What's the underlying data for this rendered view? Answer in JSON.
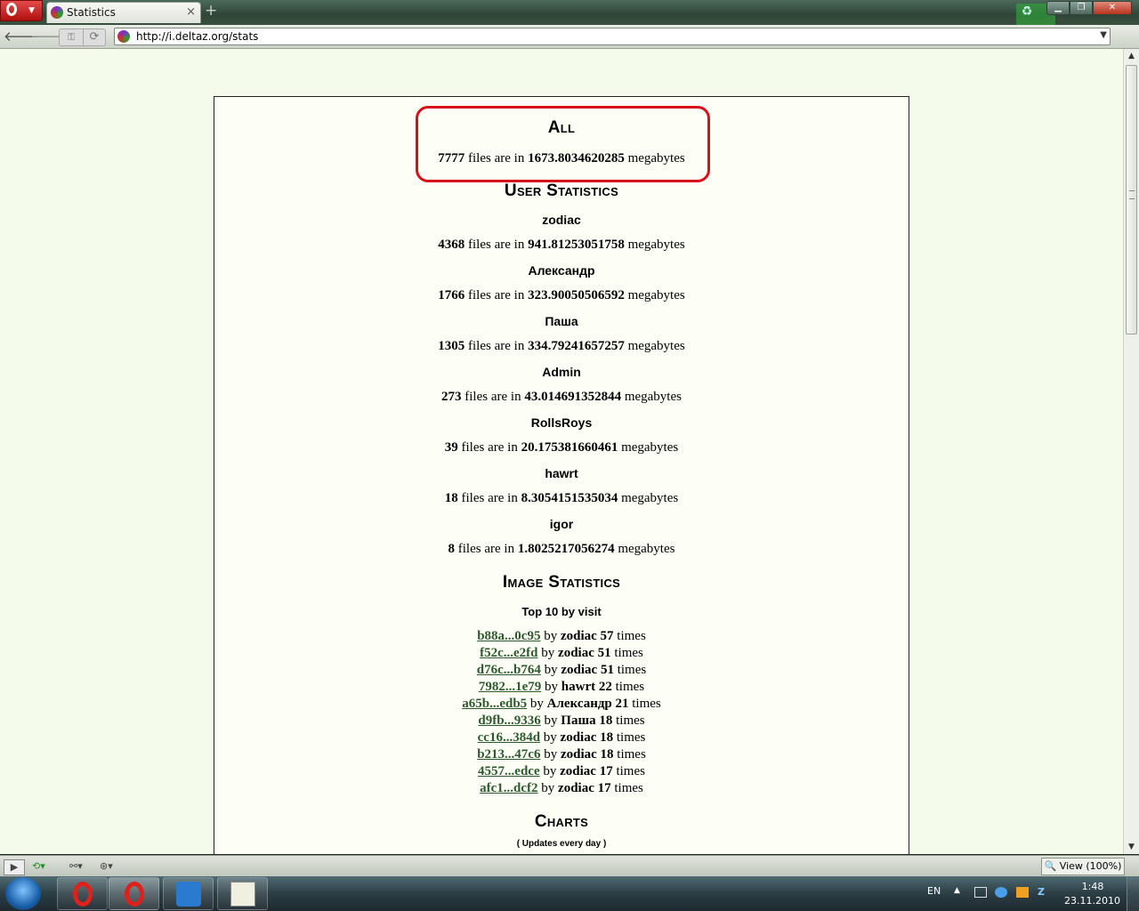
{
  "browser": {
    "tab_title": "Statistics",
    "tab_close": "×",
    "new_tab": "+",
    "url": "http://i.deltaz.org/stats",
    "zoom_label": "View (100%)"
  },
  "page": {
    "all": {
      "heading": "All",
      "files": "7777",
      "megabytes": "1673.8034620285",
      "mid_text": " files are in ",
      "unit_text": " megabytes"
    },
    "user_stats": {
      "heading": "User Statistics",
      "users": [
        {
          "name": "zodiac",
          "files": "4368",
          "megabytes": "941.81253051758"
        },
        {
          "name": "Александр",
          "files": "1766",
          "megabytes": "323.90050506592"
        },
        {
          "name": "Паша",
          "files": "1305",
          "megabytes": "334.79241657257"
        },
        {
          "name": "Admin",
          "files": "273",
          "megabytes": "43.014691352844"
        },
        {
          "name": "RollsRoys",
          "files": "39",
          "megabytes": "20.175381660461"
        },
        {
          "name": "hawrt",
          "files": "18",
          "megabytes": "8.3054151535034"
        },
        {
          "name": "igor",
          "files": "8",
          "megabytes": "1.8025217056274"
        }
      ]
    },
    "image_stats": {
      "heading": "Image Statistics",
      "subheading": "Top 10 by visit",
      "by_text": " by ",
      "times_text": " times",
      "items": [
        {
          "id": "b88a...0c95",
          "user": "zodiac",
          "count": "57"
        },
        {
          "id": "f52c...e2fd",
          "user": "zodiac",
          "count": "51"
        },
        {
          "id": "d76c...b764",
          "user": "zodiac",
          "count": "51"
        },
        {
          "id": "7982...1e79",
          "user": "hawrt",
          "count": "22"
        },
        {
          "id": "a65b...edb5",
          "user": "Александр",
          "count": "21"
        },
        {
          "id": "d9fb...9336",
          "user": "Паша",
          "count": "18"
        },
        {
          "id": "cc16...384d",
          "user": "zodiac",
          "count": "18"
        },
        {
          "id": "b213...47c6",
          "user": "zodiac",
          "count": "18"
        },
        {
          "id": "4557...edce",
          "user": "zodiac",
          "count": "17"
        },
        {
          "id": "afc1...dcf2",
          "user": "zodiac",
          "count": "17"
        }
      ]
    },
    "charts": {
      "heading": "Charts",
      "note": "( Updates every day )"
    }
  },
  "taskbar": {
    "lang": "EN",
    "time": "1:48",
    "date": "23.11.2010"
  },
  "colors": {
    "highlight": "#d8101a",
    "link": "#2d5a2d",
    "page_bg": "#f4fbea"
  }
}
